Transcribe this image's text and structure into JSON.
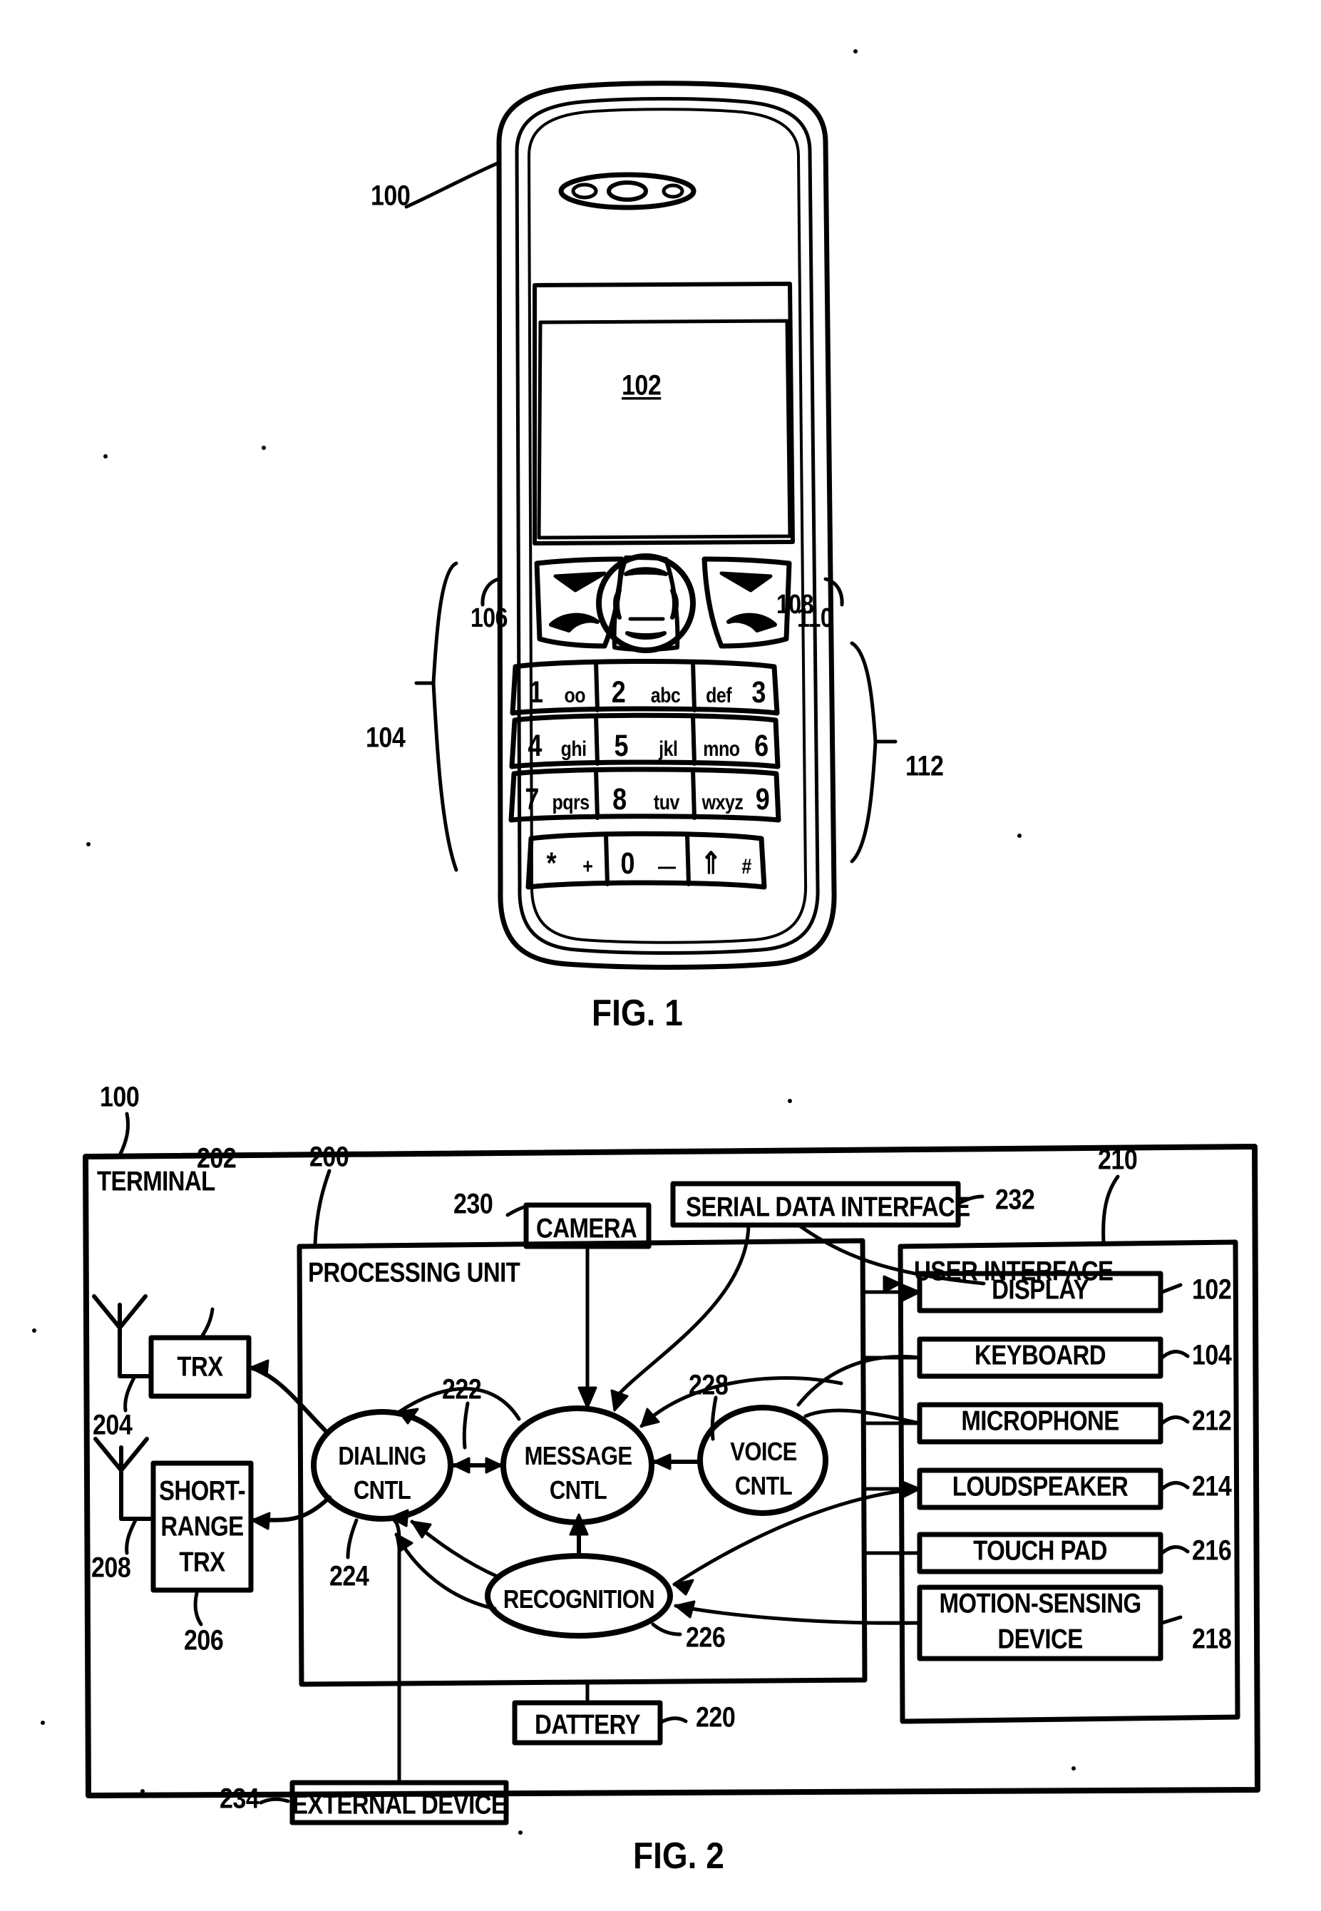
{
  "figure1": {
    "caption": "FIG. 1",
    "display_ref": "102",
    "terminal_ref": "100",
    "softkey_left_ref": "106",
    "softkey_right_ref": "110",
    "navkey_ref": "108",
    "keyboard_bracket_ref": "104",
    "keypad_bracket_ref": "112",
    "keypad": [
      [
        {
          "num": "1",
          "letters": "oo"
        },
        {
          "num": "2",
          "letters": "abc"
        },
        {
          "letters": "def",
          "num": "3",
          "reverse": true
        }
      ],
      [
        {
          "num": "4",
          "letters": "ghi"
        },
        {
          "num": "5",
          "letters": "jkl"
        },
        {
          "letters": "mno",
          "num": "6",
          "reverse": true
        }
      ],
      [
        {
          "num": "7",
          "letters": "pqrs"
        },
        {
          "num": "8",
          "letters": "tuv"
        },
        {
          "letters": "wxyz",
          "num": "9",
          "reverse": true
        }
      ],
      [
        {
          "num": "*",
          "letters": "+"
        },
        {
          "num": "0",
          "letters": "—"
        },
        {
          "num": "⇑",
          "letters": "#"
        }
      ]
    ]
  },
  "figure2": {
    "caption": "FIG. 2",
    "terminal": {
      "label": "TERMINAL",
      "ref": "100"
    },
    "processing_unit": {
      "label": "PROCESSING UNIT",
      "ref": "200"
    },
    "camera": {
      "label": "CAMERA",
      "ref": "230"
    },
    "serial_data_interface": {
      "label": "SERIAL DATA INTERFACE",
      "ref": "232"
    },
    "user_interface": {
      "label": "USER INTERFACE",
      "ref": "210"
    },
    "trx": {
      "label": "TRX",
      "ref": "202"
    },
    "antenna_1_ref": "204",
    "short_range_trx": {
      "label_line1": "SHORT-",
      "label_line2": "RANGE",
      "label_line3": "TRX",
      "ref": "206"
    },
    "antenna_2_ref": "208",
    "battery": {
      "label": "DATTERY",
      "ref": "220"
    },
    "external_device": {
      "label": "EXTERNAL DEVICE",
      "ref": "234"
    },
    "controls": [
      {
        "line1": "DIALING",
        "line2": "CNTL",
        "ref": "224"
      },
      {
        "line1": "MESSAGE",
        "line2": "CNTL",
        "ref": "222"
      },
      {
        "line1": "VOICE",
        "line2": "CNTL",
        "ref": "228"
      }
    ],
    "recognition": {
      "label": "RECOGNITION",
      "ref": "226"
    },
    "ui_items": [
      {
        "label": "DISPLAY",
        "ref": "102"
      },
      {
        "label": "KEYBOARD",
        "ref": "104"
      },
      {
        "label": "MICROPHONE",
        "ref": "212"
      },
      {
        "label": "LOUDSPEAKER",
        "ref": "214"
      },
      {
        "label": "TOUCH PAD",
        "ref": "216"
      },
      {
        "label_line1": "MOTION-SENSING",
        "label_line2": "DEVICE",
        "ref": "218"
      }
    ]
  },
  "colors": {
    "ink": "#000000",
    "paper": "#ffffff"
  }
}
